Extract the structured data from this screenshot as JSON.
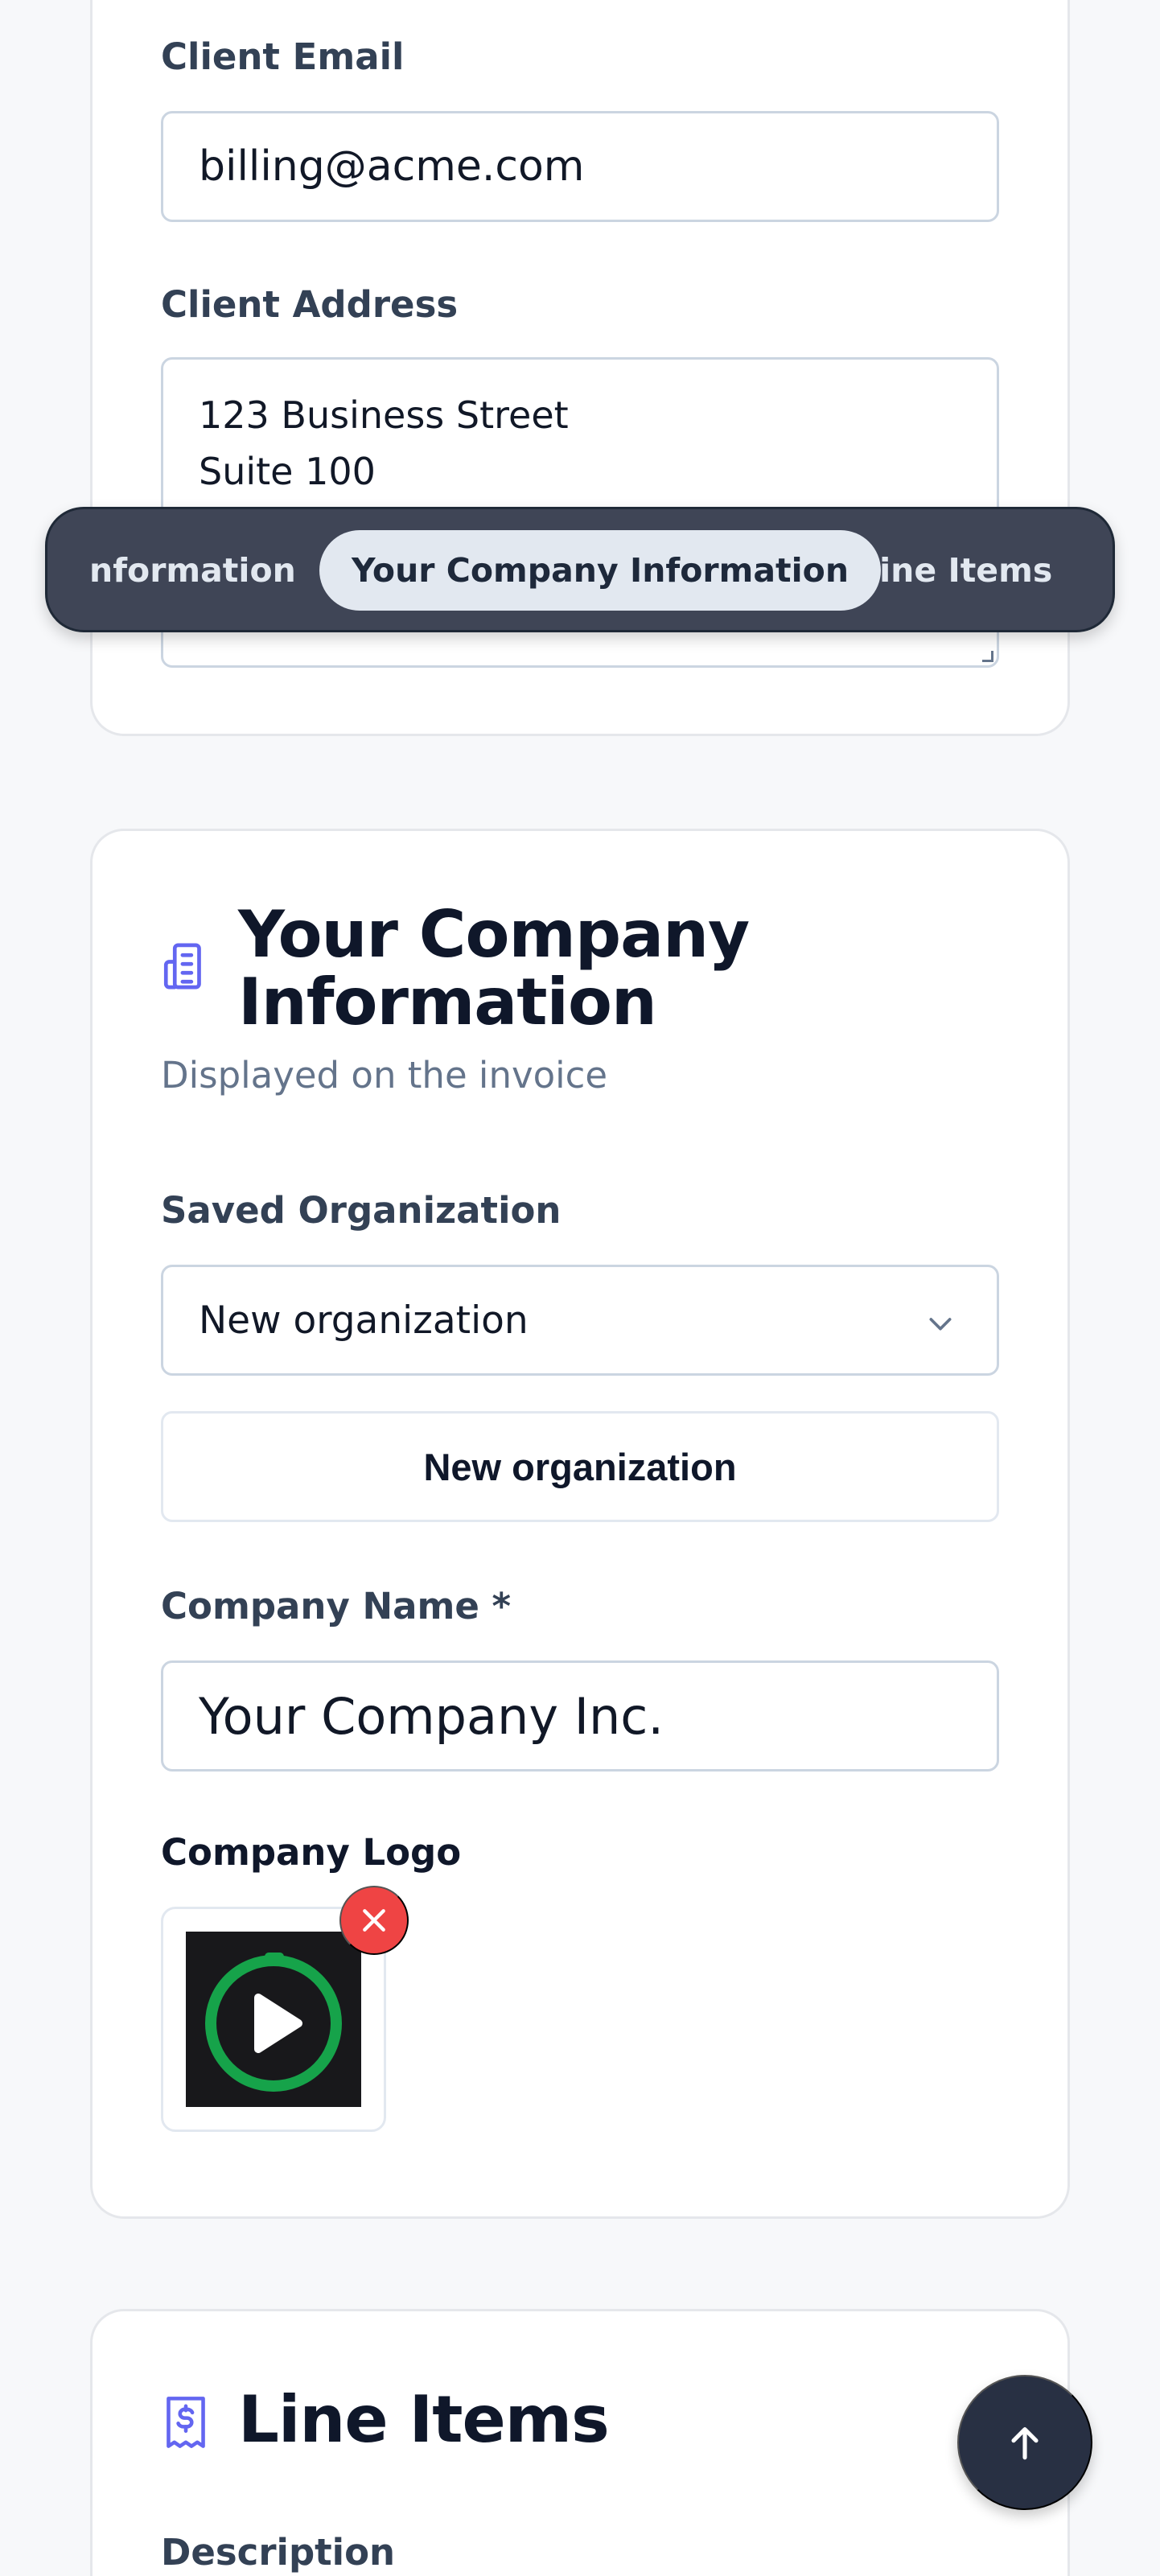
{
  "client": {
    "email_label": "Client Email",
    "email_value": "billing@acme.com",
    "address_label": "Client Address",
    "address_lines": [
      "123 Business Street",
      "Suite 100"
    ]
  },
  "nav": {
    "tabs": [
      {
        "label": "nformation",
        "state": "previous"
      },
      {
        "label": "Your Company Information",
        "state": "active"
      },
      {
        "label": "Line Items",
        "state": "next"
      }
    ]
  },
  "company": {
    "title_line1": "Your Company",
    "title_line2": "Information",
    "subtitle": "Displayed on the invoice",
    "icon": "building-icon",
    "saved_org_label": "Saved Organization",
    "saved_org_selected": "New organization",
    "new_org_button": "New organization",
    "name_label": "Company Name *",
    "name_value": "Your Company Inc.",
    "logo_label": "Company Logo",
    "logo_icon": "stopwatch-play-icon",
    "logo_colors": {
      "background": "#18181b",
      "ring": "#16a34a"
    }
  },
  "line_items": {
    "title": "Line Items",
    "icon": "receipt-dollar-icon",
    "description_label": "Description"
  },
  "colors": {
    "accent": "#6366f1",
    "danger": "#ef4444",
    "nav_background": "#3f4556",
    "fab_background": "#283043"
  }
}
